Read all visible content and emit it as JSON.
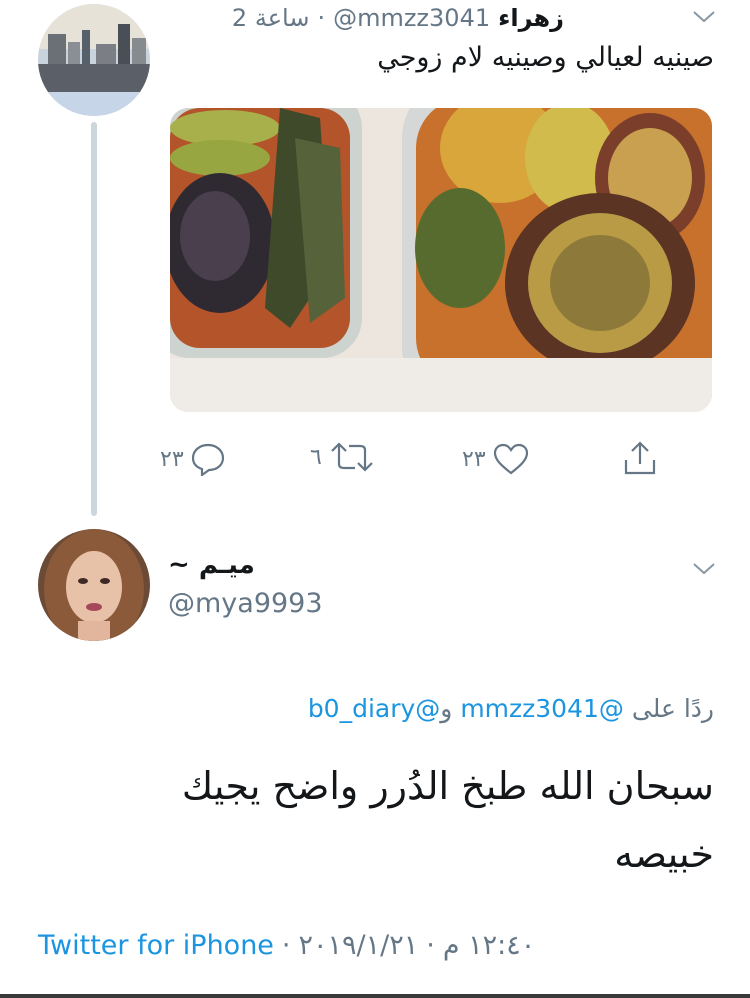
{
  "colors": {
    "link": "#1b95e0",
    "muted": "#657786",
    "thread_line": "#ccd6dd"
  },
  "parent_tweet": {
    "display_name": "زهراء",
    "handle": "@mmzz3041",
    "separator": "·",
    "time": "2 ساعة",
    "text": "صينيه لعيالي وصينيه لام زوجي",
    "actions": {
      "reply_count": "٢٣",
      "retweet_count": "٦",
      "like_count": "٢٣"
    }
  },
  "main_tweet": {
    "display_name": "ميـم ~",
    "handle": "@mya9993",
    "reply_prefix": "ردًا على",
    "reply_to_1": "@mmzz3041",
    "reply_conj": "و",
    "reply_to_2": "@b0_diary",
    "text_line1": "سبحان الله طبخ الدُرر واضح يجيك",
    "text_line2": "خبيصه",
    "time": "١٢:٤٠ م",
    "sep": "·",
    "date": "٢٠١٩/١/٢١",
    "source": "Twitter for iPhone"
  },
  "icons": {
    "menu": "chevron-down-icon",
    "reply": "reply-icon",
    "retweet": "retweet-icon",
    "like": "heart-icon",
    "share": "share-icon"
  }
}
